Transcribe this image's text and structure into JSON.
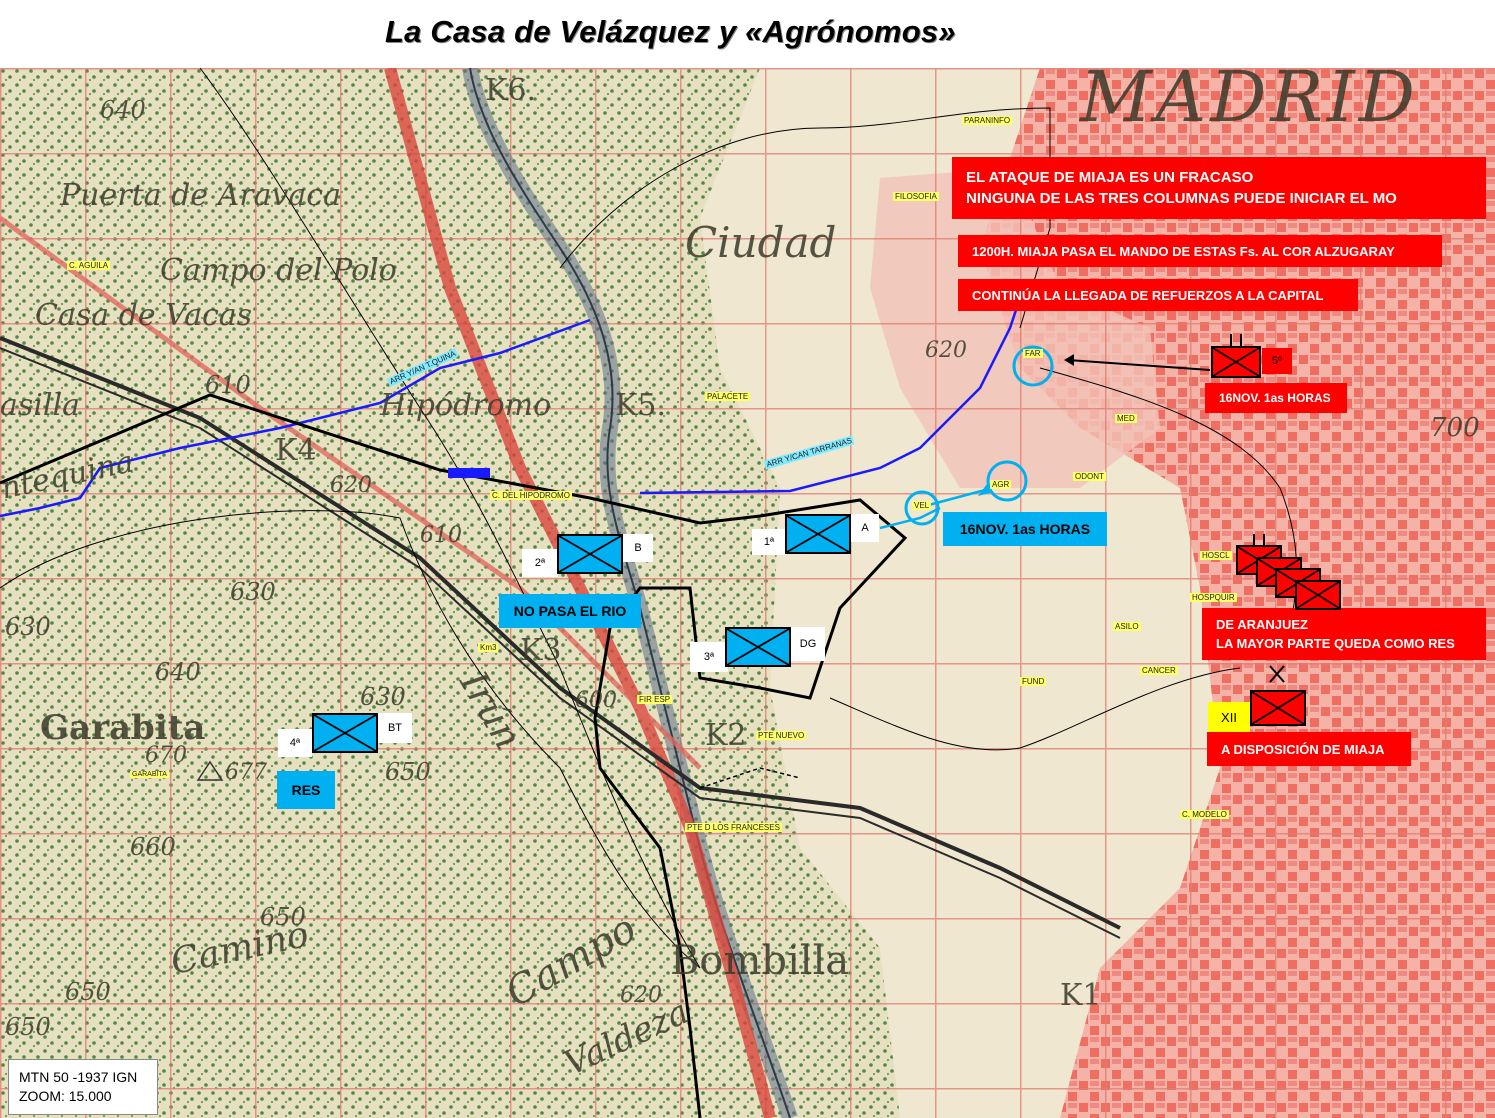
{
  "title": "La Casa de Velázquez y «Agrónomos»",
  "map_base": {
    "names": {
      "ciudad": "Ciudad",
      "puerta": "Puerta de Aravaca",
      "campo_polo": "Campo del Polo",
      "casa_vacas": "Casa de Vacas",
      "casilla": "asilla",
      "hipodromo": "Hipódromo",
      "garabita": "Garabita",
      "irun": "Irún",
      "bombilla": "Bombilla",
      "campo": "Campo",
      "camino": "Camino",
      "valdeza": "Valdeza",
      "antequina": "ntequina",
      "madrid": "MADRID",
      "k6": "K6.",
      "k5": "K5.",
      "k4": "K4",
      "k3": "K3",
      "k2": "K2",
      "k1": "K1"
    },
    "elevations": {
      "e640a": "640",
      "e610": "610",
      "e620a": "620",
      "e620b": "620",
      "e610b": "610",
      "e630a": "630",
      "e630b": "630",
      "e640b": "640",
      "e630c": "630",
      "e670": "670",
      "e677": "677",
      "e650a": "650",
      "e660": "660",
      "e650b": "650",
      "e650c": "650",
      "e650d": "650",
      "e620c": "620",
      "e600": "600",
      "e700": "700"
    }
  },
  "places": {
    "paraninfo": "PARANINFO",
    "filosofia": "FILOSOFIA",
    "aguila": "C. AGUILA",
    "far": "FAR",
    "palacete": "PALACETE",
    "med": "MED",
    "odont": "ODONT",
    "agr": "AGR",
    "vel": "VEL",
    "hipodromo_c": "C. DEL HIPODROMO",
    "arr1": "ARR Y/AN T.QUINA",
    "arr2": "ARR Y/CAN TARRANAS",
    "hoscl": "HOSCL",
    "hospquir": "HOSPQUIR",
    "asilo": "ASILO",
    "cancer": "CANCER",
    "fund": "FUND",
    "fir_esp": "FIR ESP",
    "pte_nuevo": "PTE NUEVO",
    "pte_franceses": "PTE D LOS FRANCESES",
    "c_modelo": "C. MODELO",
    "km3": "Km3",
    "garabita_s": "GARABITA"
  },
  "notes": {
    "fracaso_1": "EL ATAQUE DE MIAJA ES UN FRACASO",
    "fracaso_2": "NINGUNA DE LAS TRES COLUMNAS  PUEDE INICIAR EL MO",
    "mando": "1200H. MIAJA PASA EL MANDO DE ESTAS Fs. AL COR ALZUGARAY",
    "refuerzos": "CONTINÚA LA LLEGADA DE REFUERZOS A LA CAPITAL",
    "nov_red": "16NOV. 1as HORAS",
    "nov_blue": "16NOV. 1as HORAS",
    "no_pasa": "NO PASA EL RIO",
    "res": "RES",
    "aranjuez_1": "DE ARANJUEZ",
    "aranjuez_2": "LA MAYOR PARTE QUEDA COMO RES",
    "disposicion": "A DISPOSICIÓN DE MIAJA"
  },
  "units": {
    "blue": [
      {
        "num": "1ª",
        "tag": "A"
      },
      {
        "num": "2ª",
        "tag": "B"
      },
      {
        "num": "3ª",
        "tag": "DG"
      },
      {
        "num": "4ª",
        "tag": "BT"
      }
    ],
    "red": {
      "fifth": "5º",
      "xii": "XII"
    }
  },
  "legend": {
    "line1": "MTN 50 -1937 IGN",
    "line2": "ZOOM: 15.000"
  },
  "colors": {
    "nationalist": "#00b0f0",
    "republican": "#ff0000",
    "city": "#f08a80",
    "terrain": "#e9e3c4",
    "vegetation": "#4f8a44",
    "route": "#1a1aff"
  }
}
